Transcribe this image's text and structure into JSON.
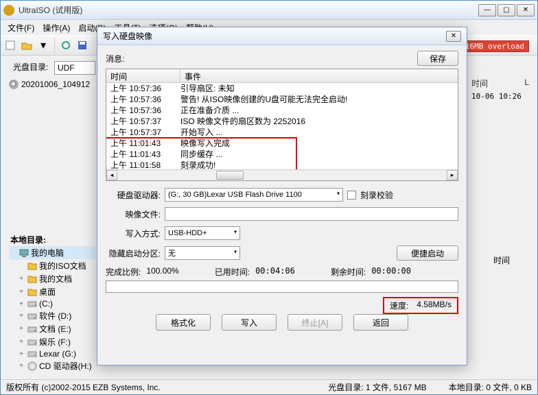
{
  "app_title": "UltraISO (试用版)",
  "menus": [
    "文件(F)",
    "操作(A)",
    "启动(B)",
    "工具(T)",
    "选项(O)",
    "帮助(H)"
  ],
  "overload_badge": ":16MB overload",
  "sidebar_label": "光盘目录:",
  "sidebar_format": "UDF",
  "disc_entry": "20201006_104912",
  "right_panel": {
    "time_hdr": "时间",
    "date_val": "10-06 10:26",
    "col_l": "L",
    "time_label2": "时间"
  },
  "local_label": "本地目录:",
  "local_tree": [
    {
      "level": 0,
      "icon": "computer",
      "label": "我的电脑",
      "selected": true
    },
    {
      "level": 1,
      "icon": "folder-sel",
      "label": "我的ISO文档",
      "selected": false
    },
    {
      "level": 1,
      "icon": "folder",
      "label": "我的文档",
      "exp": "+"
    },
    {
      "level": 1,
      "icon": "folder",
      "label": "桌面",
      "exp": "+"
    },
    {
      "level": 1,
      "icon": "drive",
      "label": "(C:)",
      "exp": "+"
    },
    {
      "level": 1,
      "icon": "drive",
      "label": "软件 (D:)",
      "exp": "+"
    },
    {
      "level": 1,
      "icon": "drive",
      "label": "文档 (E:)",
      "exp": "+"
    },
    {
      "level": 1,
      "icon": "drive",
      "label": "娱乐 (F:)",
      "exp": "+"
    },
    {
      "level": 1,
      "icon": "drive",
      "label": "Lexar (G:)",
      "exp": "+"
    },
    {
      "level": 1,
      "icon": "cd",
      "label": "CD 驱动器(H:)",
      "exp": "+"
    }
  ],
  "status": {
    "copyright": "版权所有 (c)2002-2015 EZB Systems, Inc.",
    "disc_dir": "光盘目录: 1 文件, 5167 MB",
    "local_dir": "本地目录: 0 文件, 0 KB"
  },
  "dialog": {
    "title": "写入硬盘映像",
    "msg_label": "消息:",
    "save_btn": "保存",
    "log_headers": {
      "time": "时间",
      "event": "事件"
    },
    "log": [
      {
        "t": "上午 10:57:36",
        "e": "引导扇区: 未知"
      },
      {
        "t": "上午 10:57:36",
        "e": "警告! 从ISO映像创建的U盘可能无法完全启动!"
      },
      {
        "t": "上午 10:57:36",
        "e": "正在准备介质 ..."
      },
      {
        "t": "上午 10:57:37",
        "e": "ISO 映像文件的扇区数为 2252016"
      },
      {
        "t": "上午 10:57:37",
        "e": "开始写入 ..."
      },
      {
        "t": "上午 11:01:43",
        "e": "映像写入完成"
      },
      {
        "t": "上午 11:01:43",
        "e": "同步缓存 ..."
      },
      {
        "t": "上午 11:01:58",
        "e": "刻录成功!"
      }
    ],
    "form": {
      "drive_label": "硬盘驱动器:",
      "drive_val": "(G:, 30 GB)Lexar   USB Flash Drive 1100",
      "verify_label": "刻录校验",
      "image_label": "映像文件:",
      "image_val": "",
      "write_mode_label": "写入方式:",
      "write_mode_val": "USB-HDD+",
      "hidden_label": "隐藏启动分区:",
      "hidden_val": "无",
      "quick_boot_btn": "便捷启动"
    },
    "stats": {
      "progress_label": "完成比例:",
      "progress_val": "100.00%",
      "elapsed_label": "已用时间:",
      "elapsed_val": "00:04:06",
      "remain_label": "剩余时间:",
      "remain_val": "00:00:00",
      "speed_label": "速度:",
      "speed_val": "4.58MB/s"
    },
    "buttons": {
      "format": "格式化",
      "write": "写入",
      "abort": "终止[A]",
      "back": "返回"
    }
  },
  "chart_data": {
    "type": "table",
    "title": "写入硬盘映像 log",
    "columns": [
      "时间",
      "事件"
    ],
    "rows": [
      [
        "上午 10:57:36",
        "引导扇区: 未知"
      ],
      [
        "上午 10:57:36",
        "警告! 从ISO映像创建的U盘可能无法完全启动!"
      ],
      [
        "上午 10:57:36",
        "正在准备介质 ..."
      ],
      [
        "上午 10:57:37",
        "ISO 映像文件的扇区数为 2252016"
      ],
      [
        "上午 10:57:37",
        "开始写入 ..."
      ],
      [
        "上午 11:01:43",
        "映像写入完成"
      ],
      [
        "上午 11:01:43",
        "同步缓存 ..."
      ],
      [
        "上午 11:01:58",
        "刻录成功!"
      ]
    ]
  }
}
